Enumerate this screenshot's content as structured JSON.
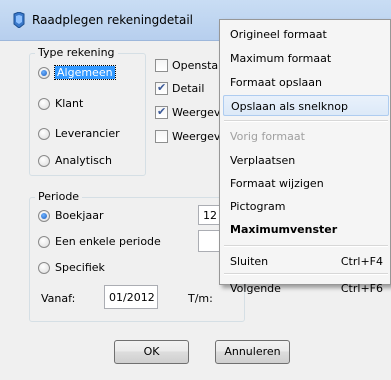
{
  "window": {
    "title": "Raadplegen rekeningdetail"
  },
  "type_rekening": {
    "label": "Type rekening",
    "options": [
      {
        "label": "Algemeen",
        "selected": true
      },
      {
        "label": "Klant",
        "selected": false
      },
      {
        "label": "Leverancier",
        "selected": false
      },
      {
        "label": "Analytisch",
        "selected": false
      }
    ]
  },
  "checks": [
    {
      "label": "Opensta",
      "checked": false
    },
    {
      "label": "Detail",
      "checked": true
    },
    {
      "label": "Weergev",
      "checked": true
    },
    {
      "label": "Weergev",
      "checked": false
    }
  ],
  "periode": {
    "label": "Periode",
    "options": [
      {
        "label": "Boekjaar",
        "selected": true
      },
      {
        "label": "Een enkele periode",
        "selected": false
      },
      {
        "label": "Specifiek",
        "selected": false
      }
    ],
    "boekjaar_value": "12",
    "vanaf_label": "Vanaf:",
    "vanaf_value": "01/2012",
    "tm_label": "T/m:"
  },
  "buttons": {
    "ok": "OK",
    "annuleren": "Annuleren"
  },
  "context_menu": {
    "items": [
      {
        "label": "Origineel formaat",
        "shortcut": "",
        "state": "normal"
      },
      {
        "label": "Maximum formaat",
        "shortcut": "",
        "state": "normal"
      },
      {
        "label": "Formaat opslaan",
        "shortcut": "",
        "state": "normal"
      },
      {
        "label": "Opslaan als snelknop",
        "shortcut": "",
        "state": "highlighted"
      },
      {
        "label": "Vorig formaat",
        "shortcut": "",
        "state": "disabled"
      },
      {
        "label": "Verplaatsen",
        "shortcut": "",
        "state": "normal"
      },
      {
        "label": "Formaat wijzigen",
        "shortcut": "",
        "state": "normal"
      },
      {
        "label": "Pictogram",
        "shortcut": "",
        "state": "normal"
      },
      {
        "label": "Maximumvenster",
        "shortcut": "",
        "state": "bold"
      },
      {
        "label": "Sluiten",
        "shortcut": "Ctrl+F4",
        "state": "normal"
      },
      {
        "label": "Volgende",
        "shortcut": "Ctrl+F6",
        "state": "normal"
      }
    ]
  },
  "colors": {
    "titlebar": "#c9ddf4",
    "selection": "#3399ff",
    "menu_highlight": "#dce9f8"
  }
}
